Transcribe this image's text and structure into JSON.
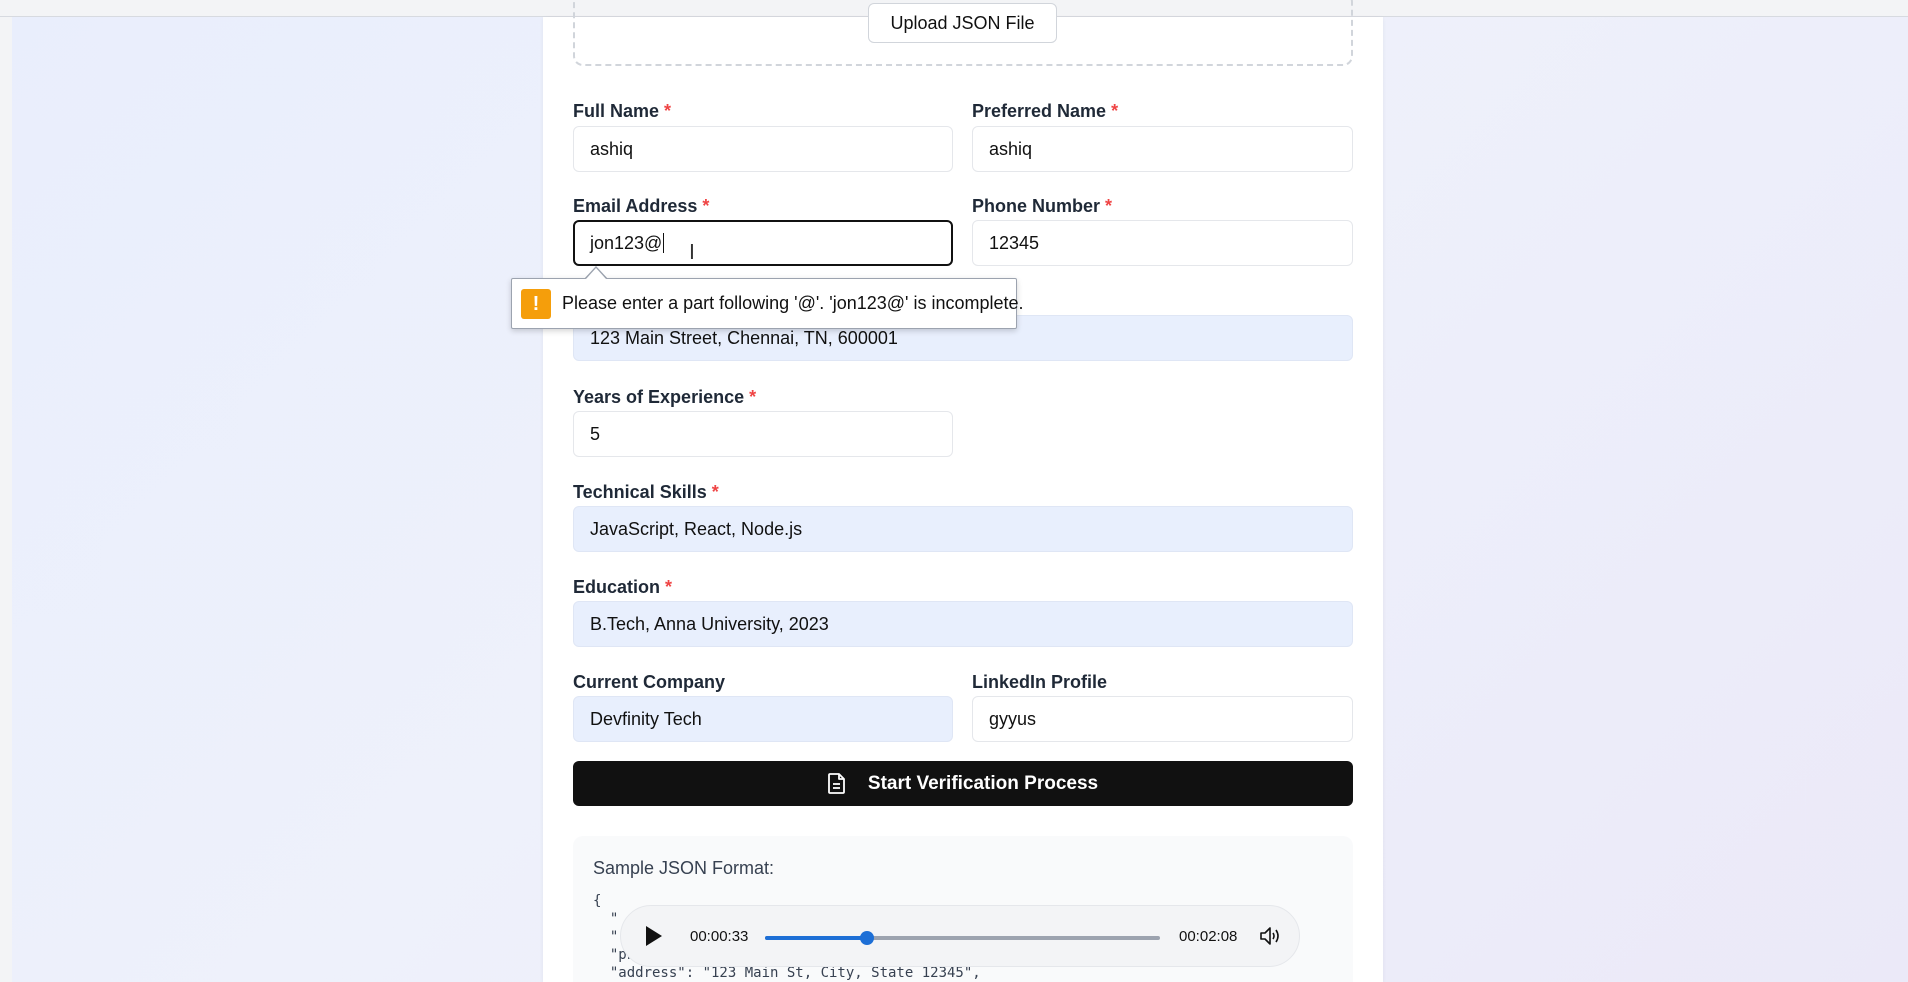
{
  "upload": {
    "button_label": "Upload JSON File"
  },
  "form": {
    "required_marker": "*",
    "full_name": {
      "label": "Full Name",
      "value": "ashiq"
    },
    "preferred_name": {
      "label": "Preferred Name",
      "value": "ashiq"
    },
    "email": {
      "label": "Email Address",
      "value": "jon123@"
    },
    "phone": {
      "label": "Phone Number",
      "value": "12345"
    },
    "address": {
      "value": "123 Main Street, Chennai, TN, 600001"
    },
    "experience": {
      "label": "Years of Experience",
      "value": "5"
    },
    "skills": {
      "label": "Technical Skills",
      "value": "JavaScript, React, Node.js"
    },
    "education": {
      "label": "Education",
      "value": "B.Tech, Anna University, 2023"
    },
    "company": {
      "label": "Current Company",
      "value": "Devfinity Tech"
    },
    "linkedin": {
      "label": "LinkedIn Profile",
      "value": "gyyus"
    },
    "submit_label": "Start Verification Process"
  },
  "validation": {
    "message": "Please enter a part following '@'. 'jon123@' is incomplete.",
    "icon_text": "!"
  },
  "sample": {
    "title": "Sample JSON Format:",
    "lines": [
      "{",
      "  \"",
      "  \"",
      "  \"phone\": \"+1-555-123-4567\",",
      "  \"address\": \"123 Main St, City, State 12345\","
    ]
  },
  "player": {
    "current_time": "00:00:33",
    "total_time": "00:02:08",
    "progress": 0.258
  },
  "colors": {
    "accent": "#1d6fd6",
    "required": "#ef4444",
    "warning": "#f59e0b",
    "filled_field": "#e8effd"
  }
}
